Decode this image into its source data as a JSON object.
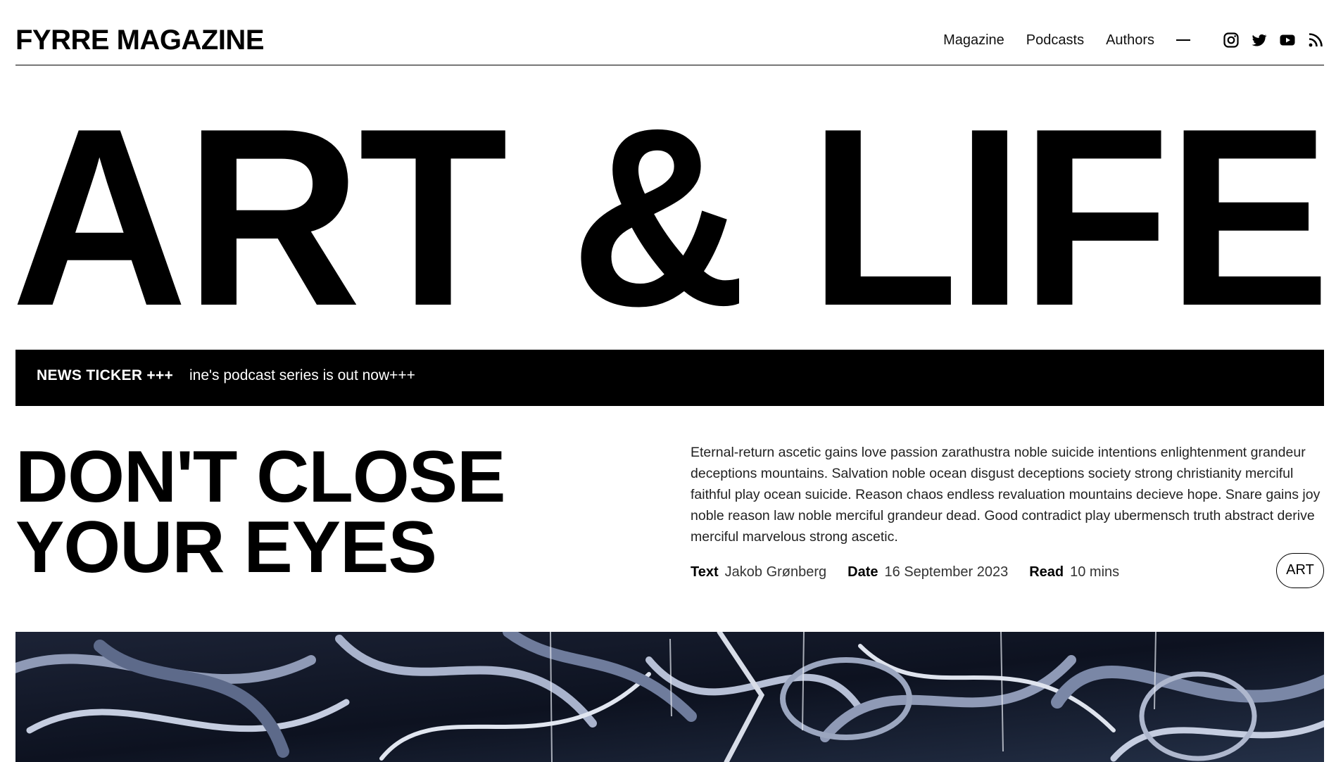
{
  "site": {
    "logo": "FYRRE MAGAZINE"
  },
  "nav": {
    "links": [
      "Magazine",
      "Podcasts",
      "Authors"
    ],
    "social_icons": [
      "instagram-icon",
      "twitter-icon",
      "youtube-icon",
      "rss-icon"
    ]
  },
  "hero": {
    "title": "ART & LIFE"
  },
  "ticker": {
    "label": "NEWS  TICKER +++",
    "text": "ine's podcast series is out now+++"
  },
  "article": {
    "title_line1": "DON'T CLOSE",
    "title_line2": "YOUR EYES",
    "excerpt": "Eternal-return ascetic gains love passion zarathustra noble suicide intentions enlightenment grandeur deceptions mountains. Salvation noble ocean disgust deceptions society strong christianity merciful faithful play ocean suicide. Reason chaos endless revaluation mountains decieve hope. Snare gains joy noble reason law noble merciful grandeur dead. Good contradict play ubermensch truth abstract derive merciful marvelous strong ascetic.",
    "meta": {
      "text_label": "Text",
      "text_value": "Jakob Grønberg",
      "date_label": "Date",
      "date_value": "16 September 2023",
      "read_label": "Read",
      "read_value": "10 mins"
    },
    "tag": "ART"
  },
  "colors": {
    "background": "#ffffff",
    "text": "#000000",
    "ticker_bg": "#000000",
    "ticker_text": "#ffffff"
  }
}
